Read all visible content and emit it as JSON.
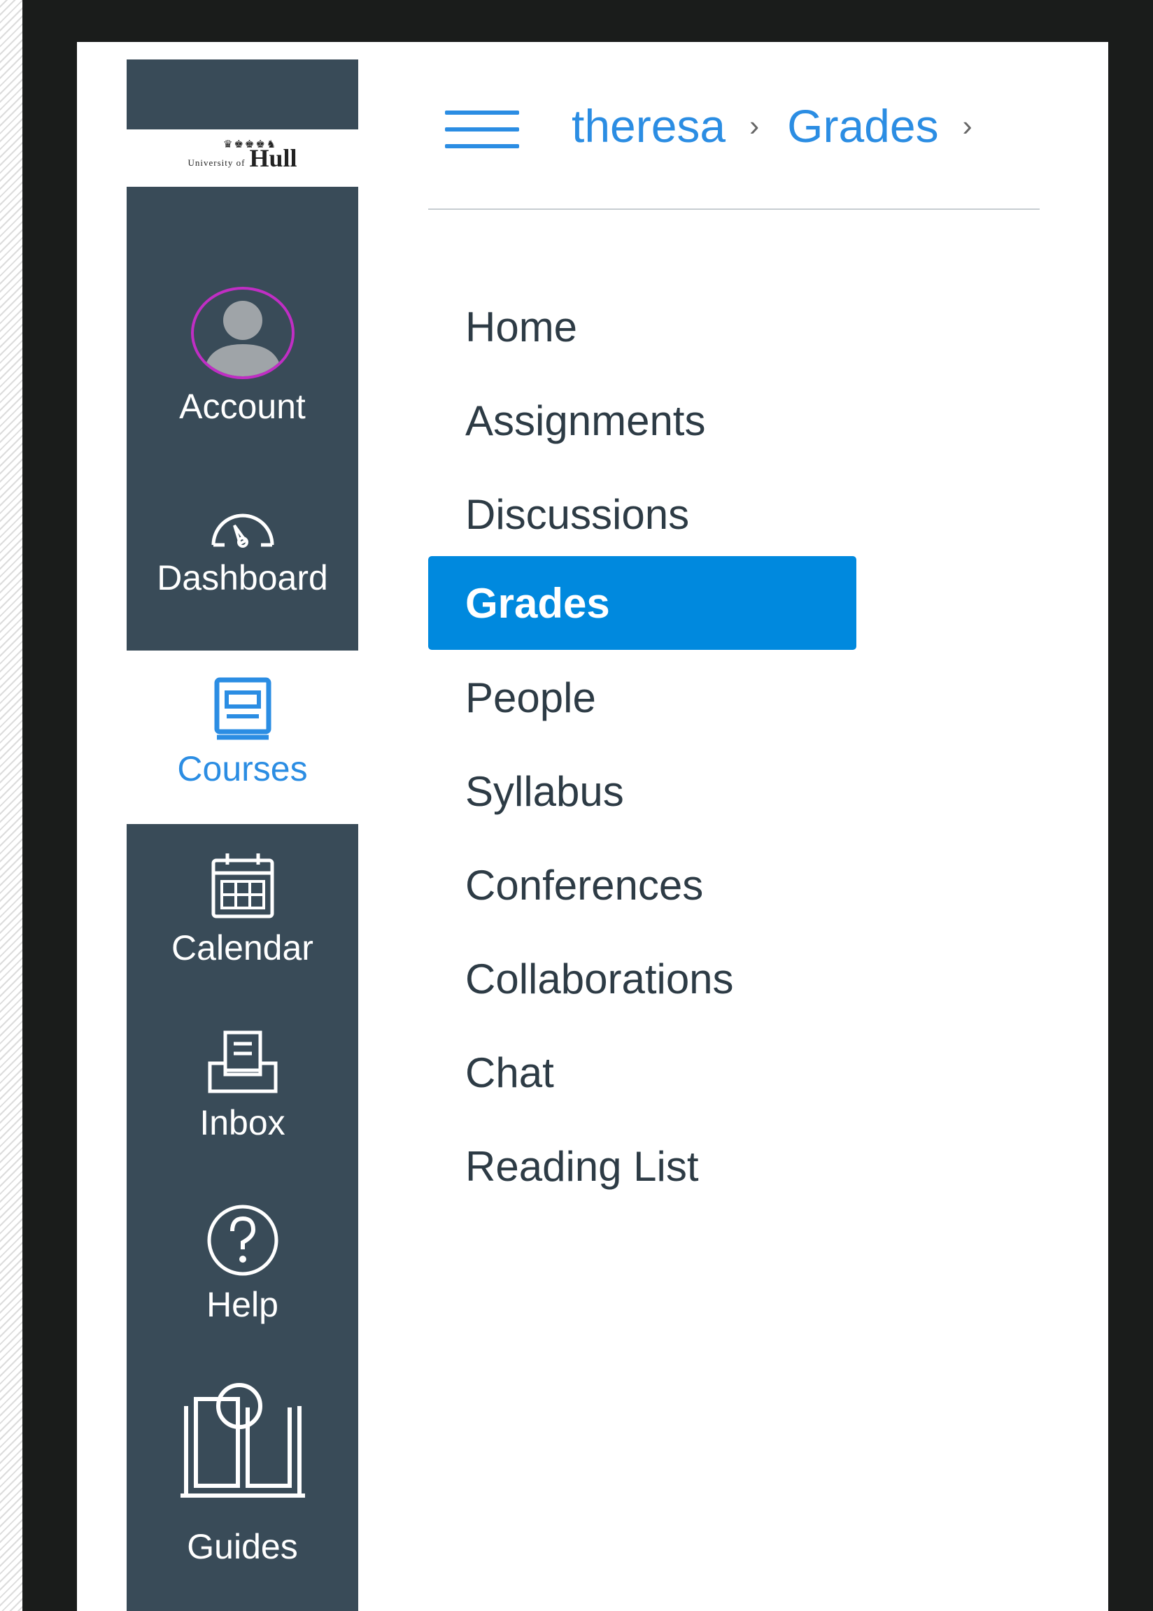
{
  "logo": {
    "top_text": "University of",
    "name": "Hull"
  },
  "global_nav": [
    {
      "label": "Account",
      "icon": "avatar-icon"
    },
    {
      "label": "Dashboard",
      "icon": "dashboard-gauge-icon"
    },
    {
      "label": "Courses",
      "icon": "courses-book-icon",
      "active": true
    },
    {
      "label": "Calendar",
      "icon": "calendar-icon"
    },
    {
      "label": "Inbox",
      "icon": "inbox-icon"
    },
    {
      "label": "Help",
      "icon": "help-question-icon"
    },
    {
      "label": "Guides",
      "icon": "guides-book-icon"
    }
  ],
  "breadcrumb": [
    "theresa",
    "Grades"
  ],
  "breadcrumb_separator": "›",
  "course_nav": [
    "Home",
    "Assignments",
    "Discussions",
    "Grades",
    "People",
    "Syllabus",
    "Conferences",
    "Collaborations",
    "Chat",
    "Reading List"
  ],
  "course_nav_active": "Grades",
  "colors": {
    "nav_bg": "#394b58",
    "accent": "#2b8de3",
    "active_bg": "#0089de",
    "avatar_ring": "#c02ec4"
  }
}
